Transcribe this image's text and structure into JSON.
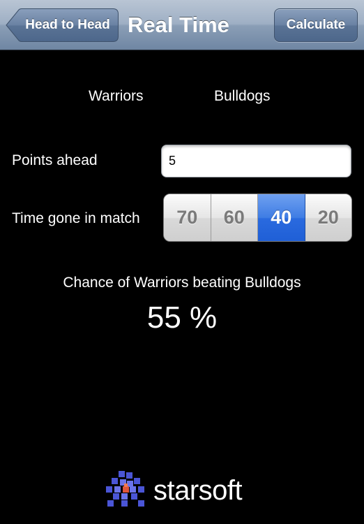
{
  "navbar": {
    "back_label": "Head to Head",
    "title": "Real Time",
    "calculate_label": "Calculate"
  },
  "teams": {
    "home": "Warriors",
    "away": "Bulldogs"
  },
  "form": {
    "points_label": "Points ahead",
    "points_value": "5",
    "time_label": "Time gone in match",
    "time_options": [
      "70",
      "60",
      "40",
      "20"
    ],
    "time_selected": "40"
  },
  "result": {
    "label": "Chance of Warriors beating Bulldogs",
    "value": "55 %"
  },
  "footer": {
    "logo_text": "starsoft",
    "logo_icon": "starsoft-logo-icon"
  },
  "colors": {
    "background": "#000000",
    "navbar": "#8a9eb6",
    "selected_segment": "#2a6adf"
  }
}
